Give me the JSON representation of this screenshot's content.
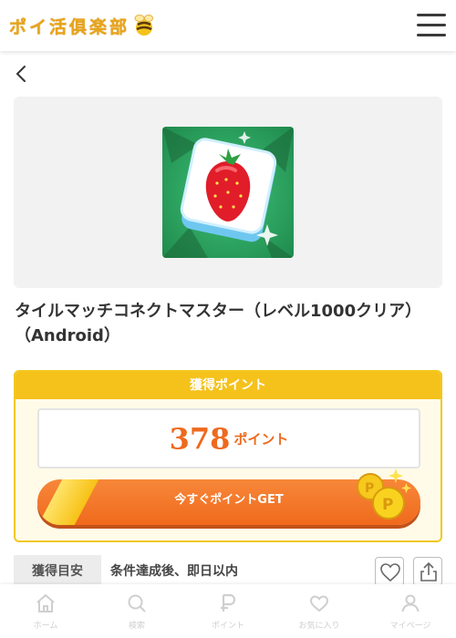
{
  "header": {
    "logo_text": "ポイ活俱楽部"
  },
  "app": {
    "title_line1": "タイルマッチコネクトマスター（レベル1000クリア）",
    "title_line2": "（Android）"
  },
  "points": {
    "heading": "獲得ポイント",
    "value": "378",
    "unit": "ポイント",
    "cta_label": "今すぐポイントGET"
  },
  "meta": {
    "label": "獲得目安",
    "value": "条件達成後、即日以内"
  },
  "bottom_nav": {
    "items": [
      {
        "label": "ホーム",
        "icon": "home-icon"
      },
      {
        "label": "検索",
        "icon": "search-icon"
      },
      {
        "label": "ポイント",
        "icon": "points-icon"
      },
      {
        "label": "お気に入り",
        "icon": "heart-icon"
      },
      {
        "label": "マイページ",
        "icon": "user-icon"
      }
    ]
  },
  "colors": {
    "accent_orange": "#f06a1c",
    "accent_yellow": "#f5c21c",
    "logo_gold": "#e8a51a"
  }
}
